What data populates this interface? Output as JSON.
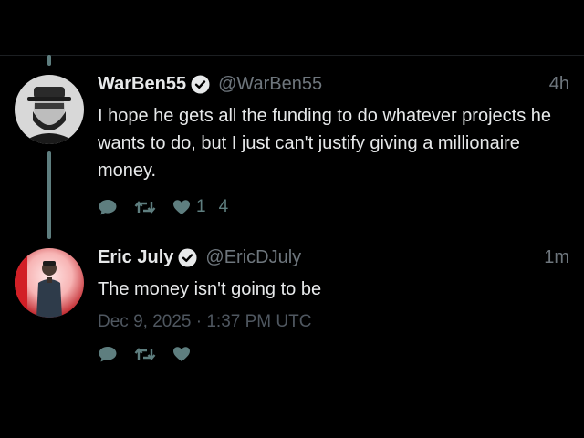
{
  "colors": {
    "background": "#000000",
    "text": "#e7e9ea",
    "muted": "#6e767d",
    "accent": "#5e7e7f"
  },
  "tweets": [
    {
      "name": "WarBen55",
      "handle": "@WarBen55",
      "time": "4h",
      "text": "I hope he gets all the funding to do whatever projects he wants to do, but I just can't justify giving a millionaire money.",
      "like_count": "1",
      "extra_count": "4",
      "icons": [
        "reply-icon",
        "retweet-icon",
        "like-icon"
      ]
    },
    {
      "name": "Eric July",
      "handle": "@EricDJuly",
      "time": "1m",
      "text": "The money isn't going to be",
      "timestamp": "Dec 9, 2025 · 1:37 PM UTC",
      "icons": [
        "reply-icon",
        "retweet-icon",
        "like-icon"
      ]
    }
  ]
}
